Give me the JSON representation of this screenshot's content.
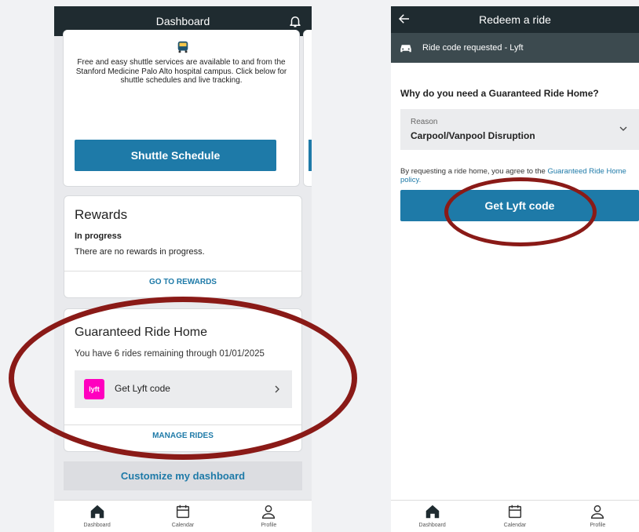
{
  "left": {
    "header": {
      "title": "Dashboard"
    },
    "shuttle": {
      "description": "Free and easy shuttle services are available to and from the Stanford Medicine Palo Alto hospital campus. Click below for shuttle schedules and live tracking.",
      "button_label": "Shuttle Schedule"
    },
    "rewards": {
      "title": "Rewards",
      "subtitle": "In progress",
      "message": "There are no rewards in progress.",
      "link_label": "GO TO REWARDS"
    },
    "grh": {
      "title": "Guaranteed Ride Home",
      "message": "You have 6 rides remaining through 01/01/2025",
      "lyft_row_label": "Get Lyft code",
      "lyft_logo_text": "lyft",
      "link_label": "MANAGE RIDES"
    },
    "customize_label": "Customize my dashboard"
  },
  "right": {
    "header": {
      "title": "Redeem a ride"
    },
    "banner_text": "Ride code requested - Lyft",
    "question": "Why do you need a Guaranteed Ride Home?",
    "reason": {
      "label": "Reason",
      "value": "Carpool/Vanpool Disruption"
    },
    "policy": {
      "prefix": "By requesting a ride home, you agree to the ",
      "link": "Guaranteed Ride Home policy."
    },
    "button_label": "Get Lyft code"
  },
  "nav": {
    "dashboard": "Dashboard",
    "calendar": "Calendar",
    "profile": "Profile"
  },
  "colors": {
    "header": "#1f2b30",
    "primary": "#1e7aa8",
    "highlight_ellipse": "#8a1a17",
    "lyft": "#ff00bf"
  }
}
